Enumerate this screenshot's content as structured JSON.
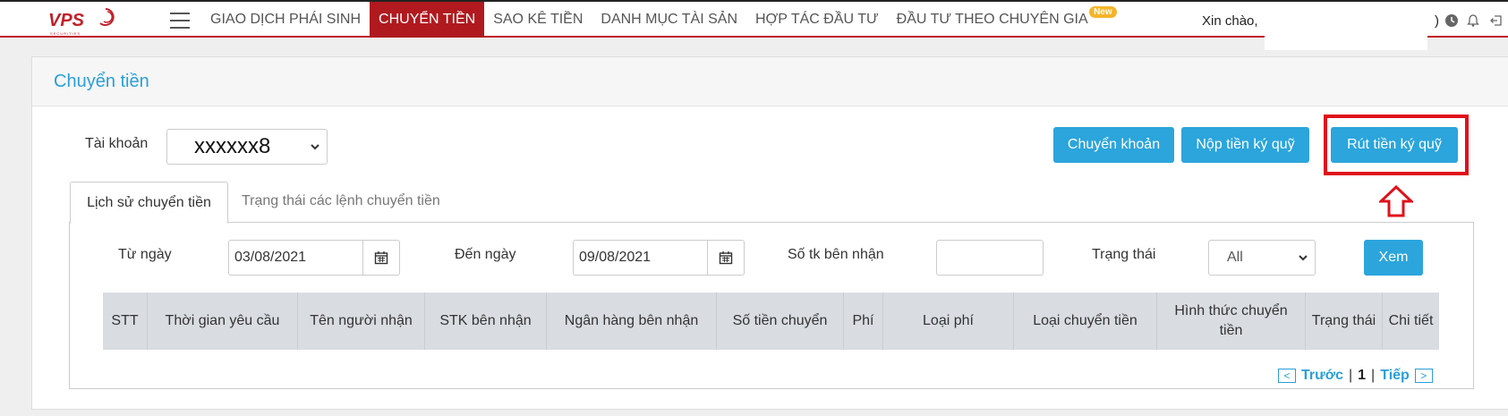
{
  "logo": {
    "text": "VPS",
    "sub": "SECURITIES"
  },
  "nav": [
    {
      "label": "GIAO DỊCH PHÁI SINH",
      "active": false
    },
    {
      "label": "CHUYỂN TIỀN",
      "active": true
    },
    {
      "label": "SAO KÊ TIỀN",
      "active": false
    },
    {
      "label": "DANH MỤC TÀI SẢN",
      "active": false
    },
    {
      "label": "HỢP TÁC ĐẦU TƯ",
      "active": false
    },
    {
      "label": "ĐẦU TƯ THEO CHUYÊN GIA",
      "active": false,
      "badge": "New"
    }
  ],
  "header": {
    "greeting": "Xin chào,",
    "greeting_tail": ")"
  },
  "panel": {
    "title": "Chuyển tiền"
  },
  "account": {
    "label": "Tài khoản",
    "value": "xxxxxx8"
  },
  "actions": {
    "transfer": "Chuyển khoản",
    "deposit_margin": "Nộp tiền ký quỹ",
    "withdraw_margin": "Rút tiền ký quỹ"
  },
  "tabs": {
    "history": "Lịch sử chuyển tiền",
    "status": "Trạng thái các lệnh chuyển tiền"
  },
  "filters": {
    "from_label": "Từ ngày",
    "from_value": "03/08/2021",
    "to_label": "Đến ngày",
    "to_value": "09/08/2021",
    "account_label": "Số tk bên nhận",
    "status_label": "Trạng thái",
    "status_value": "All",
    "view_button": "Xem"
  },
  "table": {
    "columns": [
      "STT",
      "Thời gian yêu cầu",
      "Tên người nhận",
      "STK bên nhận",
      "Ngân hàng bên nhận",
      "Số tiền chuyển",
      "Phí",
      "Loại phí",
      "Loại chuyển tiền",
      "Hình thức chuyển tiền",
      "Trạng thái",
      "Chi tiết"
    ]
  },
  "pagination": {
    "prev_symbol": "<",
    "prev": "Trước",
    "current": "1",
    "separator": "|",
    "next": "Tiếp",
    "next_symbol": ">"
  },
  "colors": {
    "brand_red": "#b01a1f",
    "accent_blue": "#2ba5dc",
    "highlight_red": "#e0101a"
  }
}
